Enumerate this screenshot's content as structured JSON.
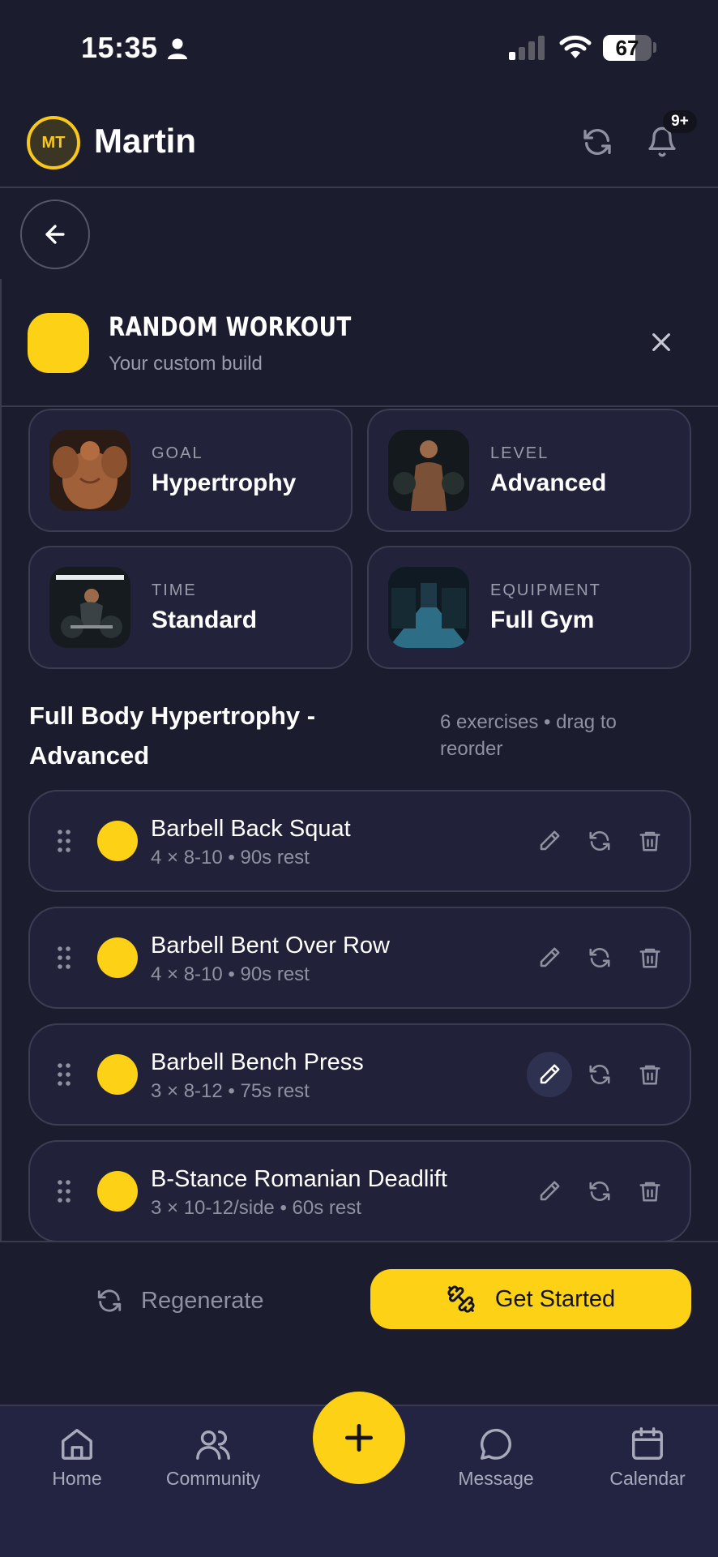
{
  "status_bar": {
    "time": "15:35",
    "battery": "67",
    "battery_fraction": 0.67
  },
  "header": {
    "avatar_initials": "MT",
    "user_name": "Martin",
    "notification_count": "9+"
  },
  "workout": {
    "title": "RANDOM WORKOUT",
    "subtitle": "Your custom build"
  },
  "info_cards": [
    {
      "label": "GOAL",
      "value": "Hypertrophy"
    },
    {
      "label": "LEVEL",
      "value": "Advanced"
    },
    {
      "label": "TIME",
      "value": "Standard"
    },
    {
      "label": "EQUIPMENT",
      "value": "Full Gym"
    }
  ],
  "plan": {
    "title": "Full Body Hypertrophy - Advanced",
    "meta": "6 exercises • drag to reorder"
  },
  "exercises": [
    {
      "name": "Barbell Back Squat",
      "detail": "4 × 8-10 • 90s rest"
    },
    {
      "name": "Barbell Bent Over Row",
      "detail": "4 × 8-10 • 90s rest"
    },
    {
      "name": "Barbell Bench Press",
      "detail": "3 × 8-12 • 75s rest"
    },
    {
      "name": "B-Stance Romanian Deadlift",
      "detail": "3 × 10-12/side • 60s rest"
    }
  ],
  "actions": {
    "regenerate": "Regenerate",
    "get_started": "Get Started"
  },
  "tabs": [
    {
      "label": "Home",
      "icon": "home-icon"
    },
    {
      "label": "Community",
      "icon": "users-icon"
    },
    {
      "label": "Message",
      "icon": "chat-icon"
    },
    {
      "label": "Calendar",
      "icon": "calendar-icon"
    }
  ],
  "colors": {
    "background": "#1b1c2e",
    "accent": "#fcd116",
    "card": "#21223a",
    "muted": "#8f90a0"
  }
}
